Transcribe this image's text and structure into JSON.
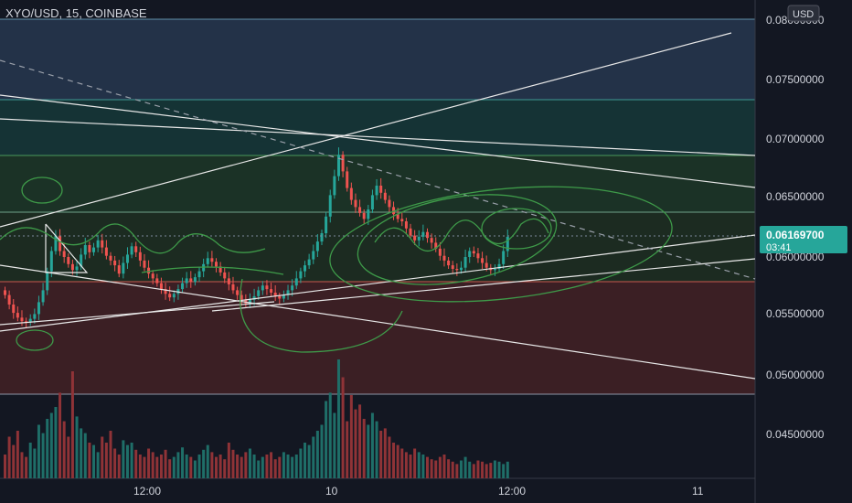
{
  "header": {
    "symbol_title": "XYO/USD, 15, COINBASE",
    "currency_button": "USD"
  },
  "chart_data": {
    "type": "candlestick",
    "symbol": "XYO/USD",
    "interval": "15",
    "exchange": "COINBASE",
    "y_ticks": [
      "0.04500000",
      "0.05000000",
      "0.05500000",
      "0.06000000",
      "0.06500000",
      "0.07000000",
      "0.07500000",
      "0.08000000"
    ],
    "x_ticks": [
      "12:00",
      "10",
      "12:00",
      "11"
    ],
    "current_price": "0.06169700",
    "countdown": "03:41",
    "up_color": "#26a69a",
    "down_color": "#ef5350",
    "closes": [
      0.0568,
      0.056,
      0.0553,
      0.0549,
      0.0546,
      0.0545,
      0.0548,
      0.0552,
      0.0562,
      0.0572,
      0.0588,
      0.0605,
      0.0618,
      0.0605,
      0.06,
      0.0594,
      0.0589,
      0.0592,
      0.0602,
      0.061,
      0.0604,
      0.0608,
      0.0614,
      0.0608,
      0.0601,
      0.0597,
      0.0593,
      0.0586,
      0.0595,
      0.0602,
      0.0609,
      0.0604,
      0.0597,
      0.0591,
      0.0586,
      0.0582,
      0.0578,
      0.0573,
      0.0569,
      0.0566,
      0.0569,
      0.0573,
      0.0578,
      0.0582,
      0.0579,
      0.0583,
      0.0588,
      0.0594,
      0.0599,
      0.0596,
      0.0592,
      0.0587,
      0.0582,
      0.0577,
      0.0572,
      0.0568,
      0.0564,
      0.0561,
      0.0564,
      0.0567,
      0.0572,
      0.0576,
      0.0573,
      0.057,
      0.0567,
      0.0565,
      0.0568,
      0.0572,
      0.0576,
      0.0582,
      0.0588,
      0.0593,
      0.0598,
      0.0605,
      0.0613,
      0.062,
      0.0634,
      0.0652,
      0.0668,
      0.0686,
      0.0672,
      0.0658,
      0.0648,
      0.0642,
      0.0637,
      0.0632,
      0.064,
      0.0652,
      0.066,
      0.0654,
      0.0648,
      0.0642,
      0.0636,
      0.0632,
      0.063,
      0.0624,
      0.0618,
      0.0614,
      0.0617,
      0.0621,
      0.0616,
      0.0612,
      0.0607,
      0.0601,
      0.0597,
      0.0593,
      0.059,
      0.0589,
      0.0591,
      0.06,
      0.0605,
      0.0603,
      0.0599,
      0.0595,
      0.0591,
      0.0589,
      0.059,
      0.0594,
      0.0605,
      0.0617
    ],
    "volumes": [
      0.2,
      0.35,
      0.28,
      0.4,
      0.22,
      0.18,
      0.3,
      0.25,
      0.45,
      0.38,
      0.5,
      0.55,
      0.6,
      0.72,
      0.48,
      0.35,
      0.9,
      0.52,
      0.42,
      0.38,
      0.3,
      0.28,
      0.22,
      0.35,
      0.3,
      0.4,
      0.25,
      0.2,
      0.32,
      0.28,
      0.3,
      0.24,
      0.2,
      0.18,
      0.25,
      0.22,
      0.18,
      0.2,
      0.24,
      0.16,
      0.18,
      0.22,
      0.26,
      0.2,
      0.18,
      0.15,
      0.2,
      0.24,
      0.28,
      0.22,
      0.18,
      0.2,
      0.16,
      0.3,
      0.24,
      0.2,
      0.18,
      0.22,
      0.25,
      0.2,
      0.15,
      0.18,
      0.2,
      0.22,
      0.16,
      0.18,
      0.22,
      0.2,
      0.18,
      0.2,
      0.25,
      0.3,
      0.28,
      0.35,
      0.4,
      0.45,
      0.65,
      0.72,
      0.55,
      1.0,
      0.85,
      0.48,
      0.7,
      0.58,
      0.62,
      0.5,
      0.45,
      0.55,
      0.48,
      0.4,
      0.42,
      0.35,
      0.3,
      0.28,
      0.25,
      0.22,
      0.2,
      0.25,
      0.22,
      0.2,
      0.18,
      0.16,
      0.15,
      0.18,
      0.2,
      0.16,
      0.14,
      0.12,
      0.15,
      0.18,
      0.14,
      0.12,
      0.15,
      0.14,
      0.12,
      0.13,
      0.15,
      0.14,
      0.12,
      0.14
    ]
  }
}
